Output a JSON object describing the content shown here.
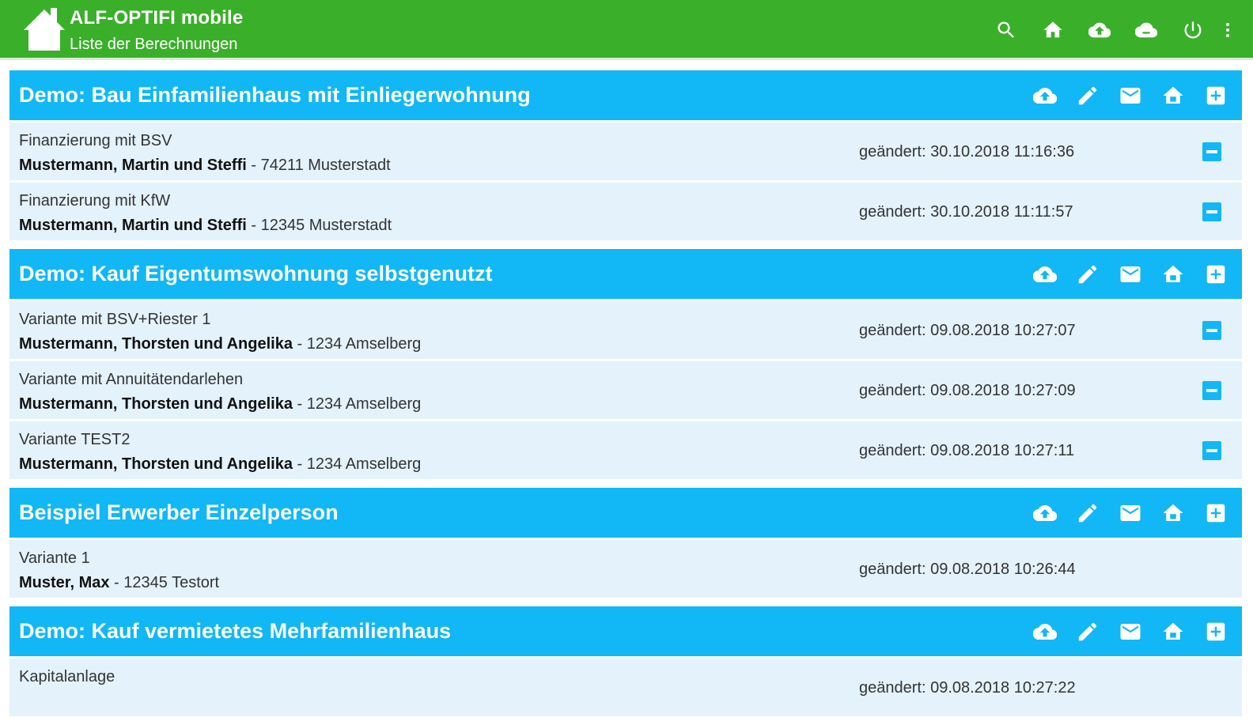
{
  "app": {
    "title": "ALF-OPTIFI mobile",
    "subtitle": "Liste der Berechnungen",
    "colors": {
      "appbar": "#3aaf2a",
      "group_header": "#12b7f5",
      "row": "#e4f2fb"
    },
    "actions": [
      "search-icon",
      "home-icon",
      "cloud-upload-icon",
      "cloud-icon",
      "power-icon",
      "more-vert-icon"
    ]
  },
  "date_prefix": "geändert:",
  "groups": [
    {
      "title": "Demo: Bau Einfamilienhaus mit Einliegerwohnung",
      "actions": [
        "cloud-upload-icon",
        "edit-icon",
        "mail-icon",
        "home-icon",
        "add-box-icon"
      ],
      "rows": [
        {
          "name": "Finanzierung mit BSV",
          "client": "Mustermann, Martin und Steffi",
          "location": " - 74211 Musterstadt",
          "date": "geändert: 30.10.2018 11:16:36",
          "removable": true
        },
        {
          "name": "Finanzierung mit KfW",
          "client": "Mustermann, Martin und Steffi",
          "location": " - 12345 Musterstadt",
          "date": "geändert: 30.10.2018 11:11:57",
          "removable": true
        }
      ]
    },
    {
      "title": "Demo: Kauf Eigentumswohnung selbstgenutzt",
      "actions": [
        "cloud-upload-icon",
        "edit-icon",
        "mail-icon",
        "home-icon",
        "add-box-icon"
      ],
      "rows": [
        {
          "name": "Variante mit BSV+Riester 1",
          "client": "Mustermann, Thorsten und Angelika",
          "location": " - 1234 Amselberg",
          "date": "geändert: 09.08.2018 10:27:07",
          "removable": true
        },
        {
          "name": "Variante mit Annuitätendarlehen",
          "client": "Mustermann, Thorsten und Angelika",
          "location": " - 1234 Amselberg",
          "date": "geändert: 09.08.2018 10:27:09",
          "removable": true
        },
        {
          "name": "Variante TEST2",
          "client": "Mustermann, Thorsten und Angelika",
          "location": " - 1234 Amselberg",
          "date": "geändert: 09.08.2018 10:27:11",
          "removable": true
        }
      ]
    },
    {
      "title": "Beispiel Erwerber Einzelperson",
      "actions": [
        "cloud-upload-icon",
        "edit-icon",
        "mail-icon",
        "home-icon",
        "add-box-icon"
      ],
      "rows": [
        {
          "name": "Variante 1",
          "client": "Muster, Max",
          "location": " - 12345 Testort",
          "date": "geändert: 09.08.2018 10:26:44",
          "removable": false
        }
      ]
    },
    {
      "title": "Demo: Kauf vermietetes Mehrfamilienhaus",
      "actions": [
        "cloud-upload-icon",
        "edit-icon",
        "mail-icon",
        "home-icon",
        "add-box-icon"
      ],
      "rows": [
        {
          "name": "Kapitalanlage",
          "client": "",
          "location": "",
          "date": "geändert: 09.08.2018 10:27:22",
          "removable": false
        }
      ]
    }
  ]
}
